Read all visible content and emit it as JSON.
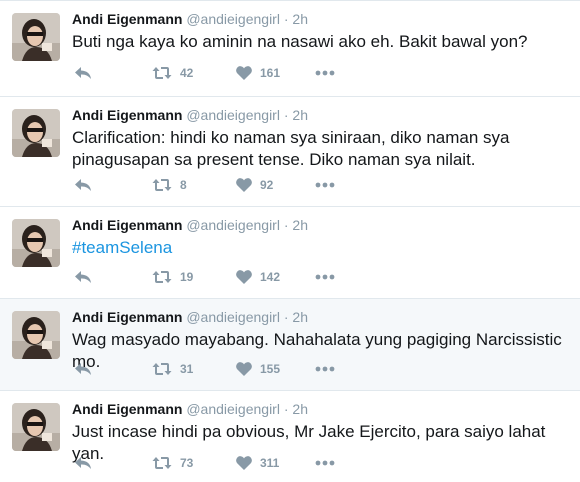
{
  "colors": {
    "link": "#1b95e0",
    "meta": "#8899a6",
    "text": "#14171a",
    "border": "#e1e8ed",
    "highlight_bg": "#f5f8fa"
  },
  "icons": {
    "reply": "reply-icon",
    "retweet": "retweet-icon",
    "like": "heart-icon",
    "more": "more-dots-icon"
  },
  "tweets": [
    {
      "name": "Andi Eigenmann",
      "handle": "@andieigengirl",
      "separator": "·",
      "time": "2h",
      "text_lines": [
        "Buti nga kaya ko aminin na nasawi ako eh. Bakit bawal yon?"
      ],
      "retweets": "42",
      "likes": "161"
    },
    {
      "name": "Andi Eigenmann",
      "handle": "@andieigengirl",
      "separator": "·",
      "time": "2h",
      "text_lines": [
        "Clarification: hindi ko naman sya siniraan, diko naman sya",
        "pinagusapan sa present tense. Diko naman sya nilait."
      ],
      "retweets": "8",
      "likes": "92"
    },
    {
      "name": "Andi Eigenmann",
      "handle": "@andieigengirl",
      "separator": "·",
      "time": "2h",
      "hashtag": "#teamSelena",
      "retweets": "19",
      "likes": "142"
    },
    {
      "name": "Andi Eigenmann",
      "handle": "@andieigengirl",
      "separator": "·",
      "time": "2h",
      "text_lines": [
        "Wag masyado mayabang. Nahahalata yung pagiging Narcissistic mo."
      ],
      "retweets": "31",
      "likes": "155",
      "highlighted": true
    },
    {
      "name": "Andi Eigenmann",
      "handle": "@andieigengirl",
      "separator": "·",
      "time": "2h",
      "text_lines": [
        "Just incase hindi pa obvious, Mr Jake Ejercito, para saiyo lahat yan."
      ],
      "retweets": "73",
      "likes": "311"
    }
  ]
}
